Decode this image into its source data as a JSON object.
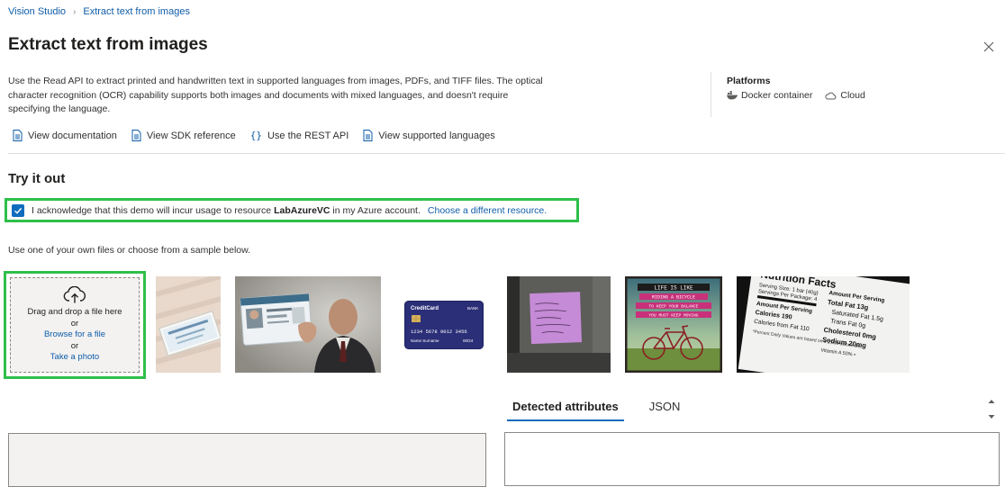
{
  "breadcrumb": {
    "home": "Vision Studio",
    "current": "Extract text from images"
  },
  "header": {
    "title": "Extract text from images"
  },
  "description": "Use the Read API to extract printed and handwritten text in supported languages from images, PDFs, and TIFF files. The optical character recognition (OCR) capability supports both images and documents with mixed languages, and doesn't require specifying the language.",
  "platforms": {
    "title": "Platforms",
    "items": [
      "Docker container",
      "Cloud"
    ]
  },
  "links": [
    "View documentation",
    "View SDK reference",
    "Use the REST API",
    "View supported languages"
  ],
  "try_it": {
    "title": "Try it out",
    "ack_prefix": "I acknowledge that this demo will incur usage to resource",
    "resource": "LabAzureVC",
    "ack_suffix": "in my Azure account.",
    "change_link": "Choose a different resource.",
    "checked": true
  },
  "upload": {
    "hint": "Use one of your own files or choose from a sample below.",
    "drag_text": "Drag and drop a file here",
    "or1": "or",
    "browse": "Browse for a file",
    "or2": "or",
    "photo": "Take a photo"
  },
  "samples": {
    "credit_card": {
      "brand": "CreditCard",
      "bank": "BANK",
      "number": "1234 5678 9012 3456",
      "name": "Name Surname",
      "expiry": "00/24"
    },
    "poster_lines": [
      "LIFE IS LIKE",
      "RIDING A BICYCLE",
      "TO KEEP YOUR BALANCE",
      "YOU MUST KEEP MOVING"
    ],
    "nutrition": {
      "title": "Nutrition Facts",
      "serving_size": "Serving Size: 1 bar (40g)",
      "servings": "Servings Per Package: 4",
      "amount_header": "Amount Per Serving",
      "calories": "Calories 190",
      "fat_calories": "Calories from Fat 110",
      "daily_note": "*Percent Daily Values are based on a 2,000 calorie diet.",
      "amount_header2": "Amount Per Serving",
      "total_fat": "Total Fat 13g",
      "sat_fat": "Saturated Fat 1.5g",
      "trans_fat": "Trans Fat 0g",
      "cholesterol": "Cholesterol 0mg",
      "sodium": "Sodium 20mg",
      "vitamin": "Vitamin A 50% • "
    }
  },
  "results": {
    "tabs": [
      "Detected attributes",
      "JSON"
    ],
    "active_tab": 0
  }
}
